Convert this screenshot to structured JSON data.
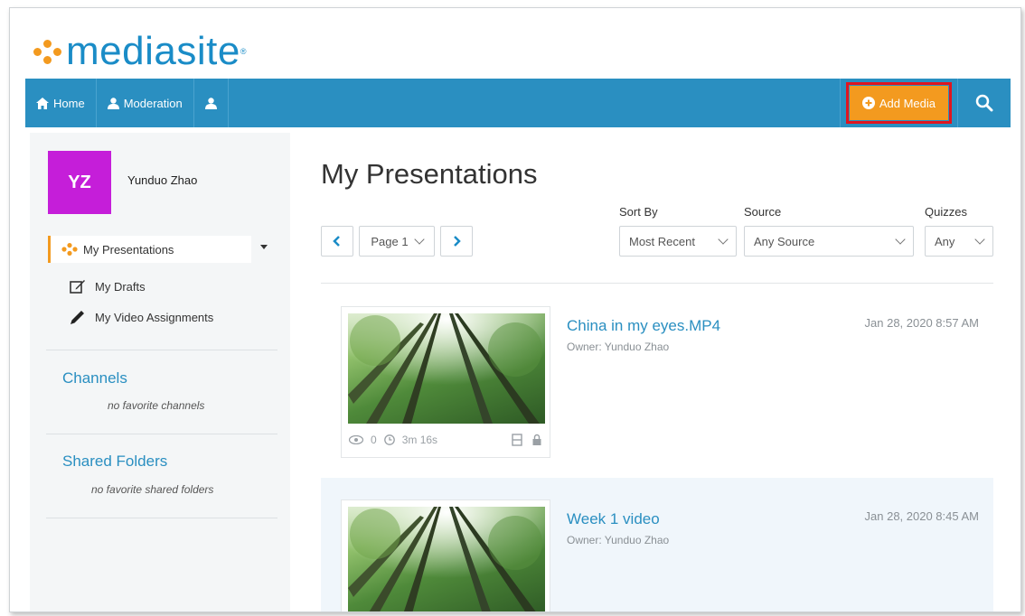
{
  "logo": {
    "text": "mediasite",
    "mark": "®"
  },
  "nav": {
    "home": "Home",
    "moderation": "Moderation",
    "add_media": "Add Media"
  },
  "colors": {
    "accent": "#2a8fc1",
    "brand_orange": "#f39a1f",
    "avatar": "#c51ed9",
    "highlight_box": "#e0151f"
  },
  "user": {
    "initials": "YZ",
    "name": "Yunduo Zhao"
  },
  "sidebar": {
    "items": [
      {
        "label": "My Presentations",
        "icon": "mediasite-icon",
        "active": true
      },
      {
        "label": "My Drafts",
        "icon": "edit-icon"
      },
      {
        "label": "My Video Assignments",
        "icon": "pencil-icon"
      }
    ],
    "channels": {
      "heading": "Channels",
      "empty": "no favorite channels"
    },
    "shared": {
      "heading": "Shared Folders",
      "empty": "no favorite shared folders"
    }
  },
  "main": {
    "title": "My Presentations",
    "pager": {
      "page": "Page 1"
    },
    "filters": {
      "sort_by": {
        "label": "Sort By",
        "value": "Most Recent"
      },
      "source": {
        "label": "Source",
        "value": "Any Source"
      },
      "quizzes": {
        "label": "Quizzes",
        "value": "Any"
      }
    },
    "presentations": [
      {
        "title": "China in my eyes.MP4",
        "owner": "Owner: Yunduo Zhao",
        "date": "Jan 28, 2020 8:57 AM",
        "views": "0",
        "duration": "3m 16s"
      },
      {
        "title": "Week 1 video",
        "owner": "Owner: Yunduo Zhao",
        "date": "Jan 28, 2020 8:45 AM"
      }
    ]
  }
}
